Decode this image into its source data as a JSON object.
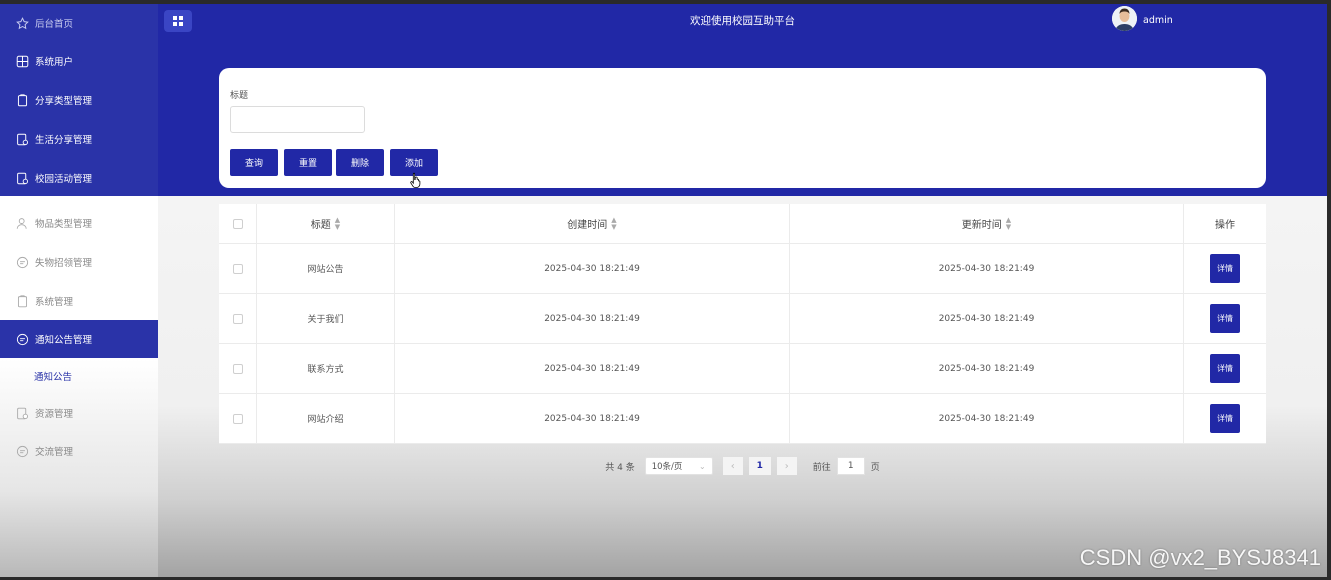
{
  "header": {
    "title": "欢迎使用校园互助平台",
    "user_name": "admin"
  },
  "sidebar": {
    "items": [
      {
        "label": "后台首页",
        "icon": "star-icon"
      },
      {
        "label": "系统用户",
        "icon": "grid-icon"
      },
      {
        "label": "分享类型管理",
        "icon": "clipboard-icon"
      },
      {
        "label": "生活分享管理",
        "icon": "document-icon"
      },
      {
        "label": "校园活动管理",
        "icon": "document-icon"
      },
      {
        "label": "物品类型管理",
        "icon": "user-icon"
      },
      {
        "label": "失物招领管理",
        "icon": "chat-icon"
      },
      {
        "label": "系统管理",
        "icon": "clipboard-icon"
      },
      {
        "label": "通知公告管理",
        "icon": "chat-icon"
      },
      {
        "label": "通知公告",
        "icon": ""
      },
      {
        "label": "资源管理",
        "icon": "document-icon"
      },
      {
        "label": "交流管理",
        "icon": "chat-icon"
      }
    ]
  },
  "search": {
    "label": "标题",
    "value": "",
    "buttons": {
      "query": "查询",
      "reset": "重置",
      "delete": "删除",
      "add": "添加"
    }
  },
  "table": {
    "headers": {
      "title": "标题",
      "created": "创建时间",
      "updated": "更新时间",
      "operation": "操作"
    },
    "rows": [
      {
        "title": "网站公告",
        "created": "2025-04-30 18:21:49",
        "updated": "2025-04-30 18:21:49",
        "action": "详情"
      },
      {
        "title": "关于我们",
        "created": "2025-04-30 18:21:49",
        "updated": "2025-04-30 18:21:49",
        "action": "详情"
      },
      {
        "title": "联系方式",
        "created": "2025-04-30 18:21:49",
        "updated": "2025-04-30 18:21:49",
        "action": "详情"
      },
      {
        "title": "网站介绍",
        "created": "2025-04-30 18:21:49",
        "updated": "2025-04-30 18:21:49",
        "action": "详情"
      }
    ]
  },
  "pagination": {
    "total": "共 4 条",
    "page_size": "10条/页",
    "current_page": "1",
    "goto_label": "前往",
    "goto_value": "1",
    "goto_suffix": "页"
  },
  "watermark": "CSDN @vx2_BYSJ8341",
  "colors": {
    "primary": "#2128a6",
    "sidebar_active": "#2a33a8"
  }
}
